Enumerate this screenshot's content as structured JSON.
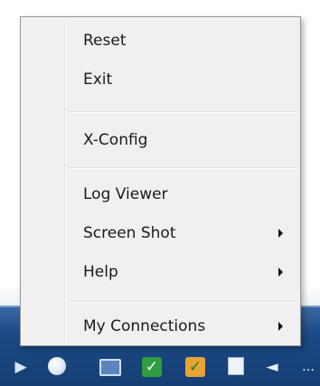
{
  "context_menu": {
    "items": [
      {
        "label": "Reset",
        "has_submenu": false
      },
      {
        "label": "Exit",
        "has_submenu": false
      },
      {
        "label": "X-Config",
        "has_submenu": false
      },
      {
        "label": "Log Viewer",
        "has_submenu": false
      },
      {
        "label": "Screen Shot",
        "has_submenu": true
      },
      {
        "label": "Help",
        "has_submenu": true
      },
      {
        "label": "My Connections",
        "has_submenu": true
      }
    ]
  },
  "taskbar": {
    "tray_icons": [
      "flag-icon",
      "circle-app-icon",
      "monitor-icon",
      "green-check-icon",
      "orange-check-icon",
      "document-icon",
      "speaker-icon",
      "more-icon"
    ]
  },
  "icons": {
    "flag": "▶",
    "check": "✓",
    "speaker": "◄",
    "dots": "…"
  },
  "colors": {
    "menu_background": "#f0f0f0",
    "menu_border": "#979797",
    "taskbar": "#1c4a86"
  }
}
